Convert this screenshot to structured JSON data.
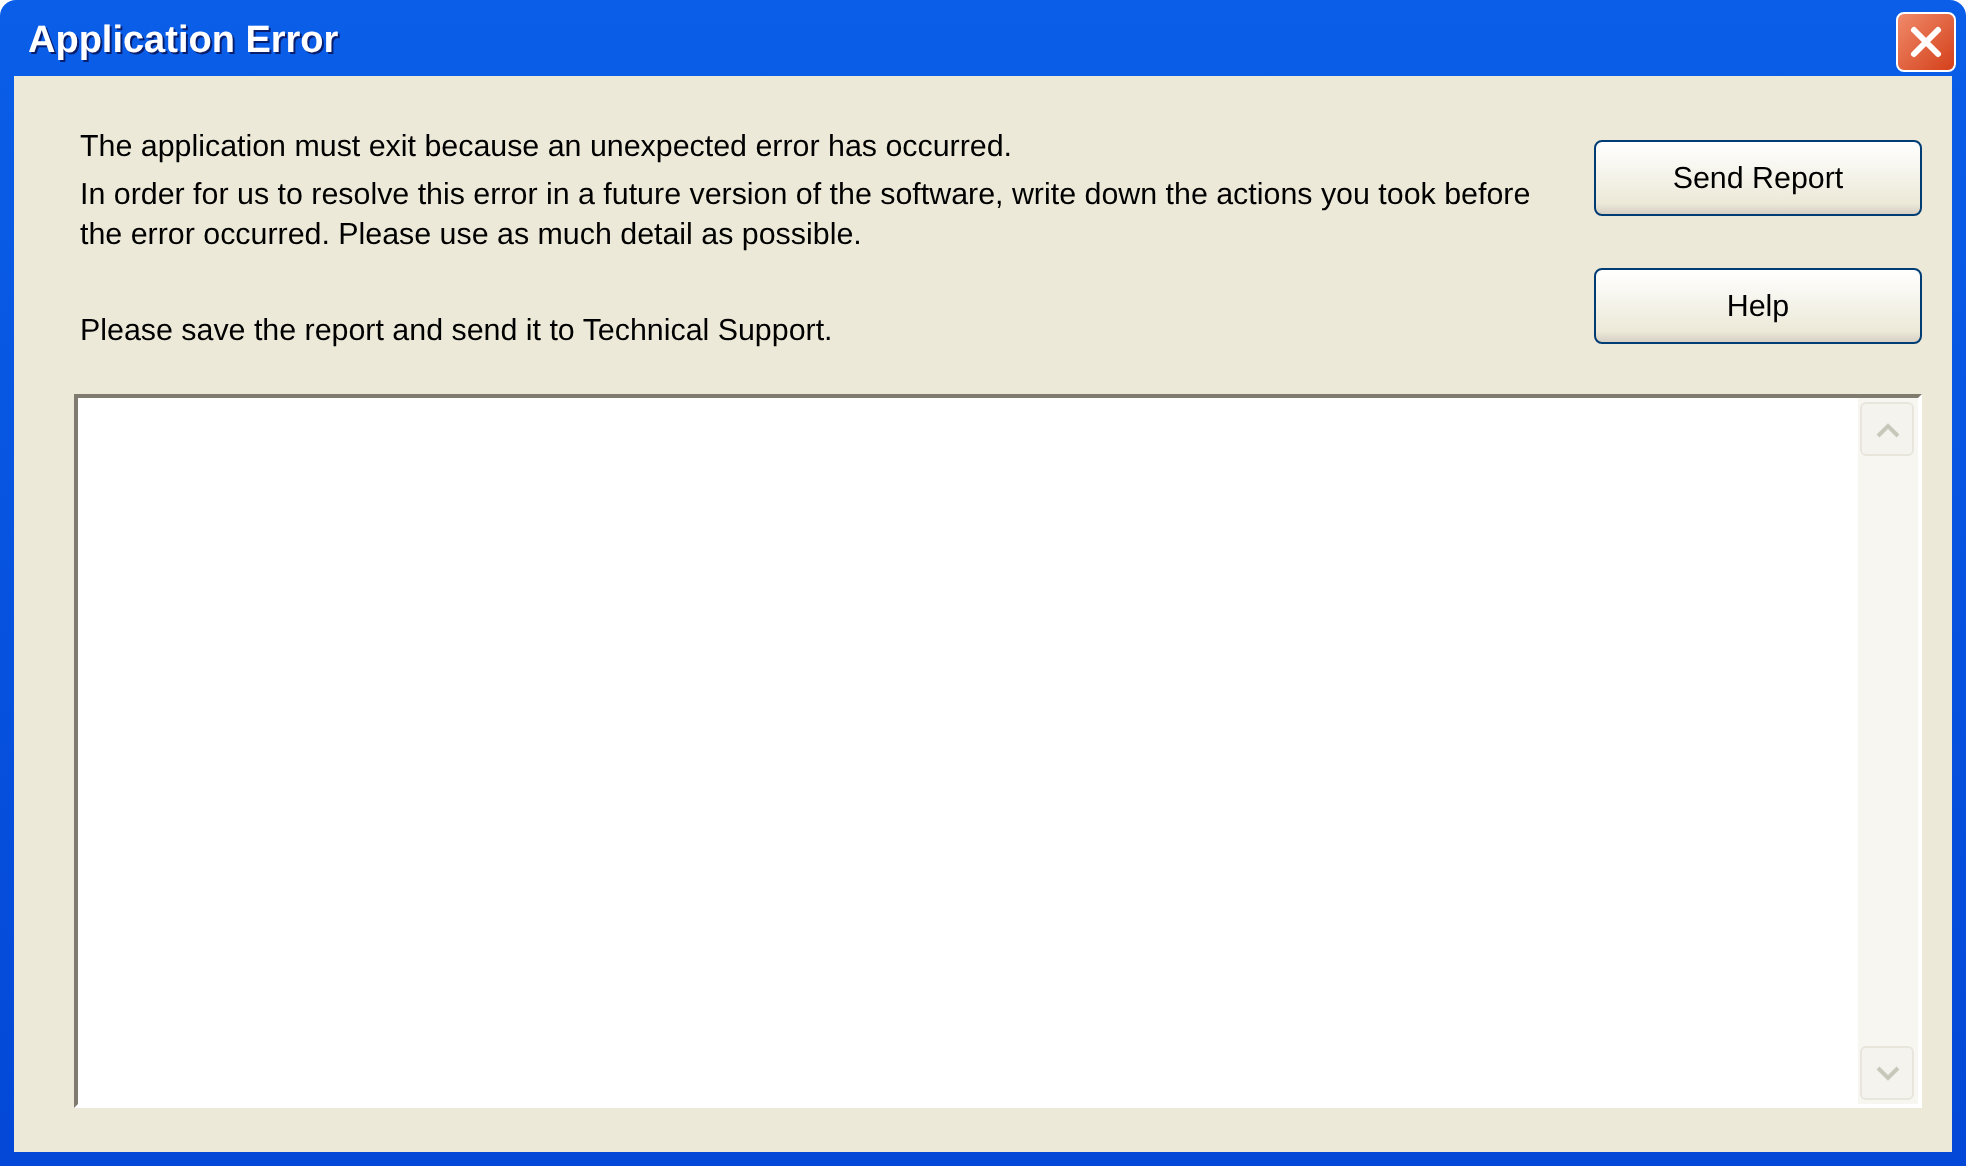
{
  "window": {
    "title": "Application Error"
  },
  "messages": [
    "The application must exit because an unexpected error has occurred.",
    "In order for us to resolve this error in a future version of the software, write down the actions you took before the error occurred. Please use as much detail as possible.",
    "Please save the report and send it to Technical Support."
  ],
  "buttons": [
    "Send Report",
    "Help"
  ]
}
